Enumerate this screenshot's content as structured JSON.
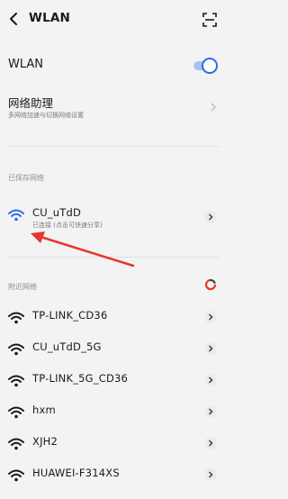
{
  "header": {
    "title": "WLAN",
    "back_icon": "chevron-left-icon",
    "scan_icon": "scan-icon"
  },
  "wlan": {
    "label": "WLAN",
    "enabled": true,
    "accent": "#2c6ce8"
  },
  "assistant": {
    "title": "网络助理",
    "subtitle": "多网络加速与切换网络设置"
  },
  "saved": {
    "section_label": "已保存网络",
    "networks": [
      {
        "name": "CU_uTdD",
        "status": "已连接 (点击可快速分享)",
        "connected": true
      }
    ]
  },
  "nearby": {
    "section_label": "附近网络",
    "networks": [
      {
        "name": "TP-LINK_CD36"
      },
      {
        "name": "CU_uTdD_5G"
      },
      {
        "name": "TP-LINK_5G_CD36"
      },
      {
        "name": "hxm"
      },
      {
        "name": "XJH2"
      },
      {
        "name": "HUAWEI-F314XS"
      }
    ]
  },
  "annotation": {
    "color": "#e8362b"
  }
}
